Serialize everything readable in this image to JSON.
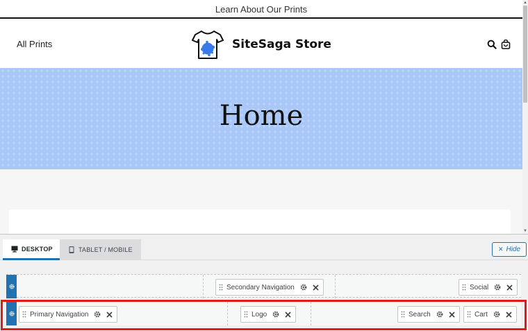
{
  "site": {
    "announcement": "Learn About Our Prints",
    "nav_link": "All Prints",
    "logo_text": "SiteSaga Store",
    "hero_title": "Home"
  },
  "builder": {
    "tabs": [
      {
        "label": "DESKTOP",
        "active": true
      },
      {
        "label": "TABLET / MOBILE",
        "active": false
      }
    ],
    "hide_label": "Hide",
    "top_row": {
      "items": [
        {
          "label": "Secondary Navigation"
        },
        {
          "label": "Social"
        }
      ]
    },
    "main_row": {
      "items": [
        {
          "label": "Primary Navigation"
        },
        {
          "label": "Logo"
        },
        {
          "label": "Search"
        },
        {
          "label": "Cart"
        }
      ]
    }
  },
  "colors": {
    "accent": "#2271b1",
    "hero_bg": "#a9c8f7",
    "highlight": "#e01a1a"
  }
}
